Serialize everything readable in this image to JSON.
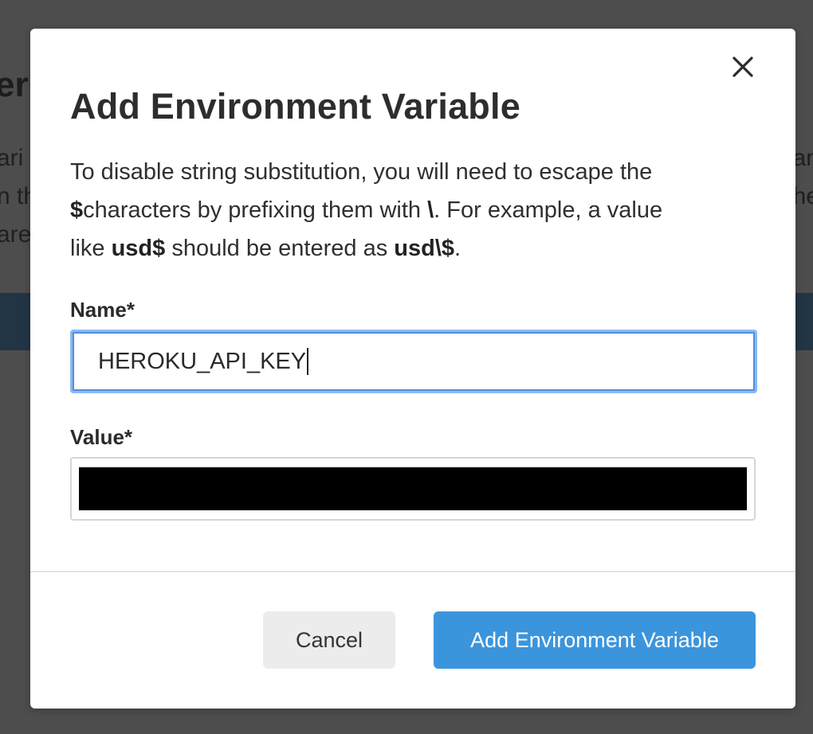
{
  "background": {
    "title_fragment": "er",
    "left_fragments": [
      "ari",
      "n th",
      "are"
    ],
    "right_fragments": [
      "an",
      "the",
      ""
    ]
  },
  "modal": {
    "title": "Add Environment Variable",
    "description": {
      "line1": "To disable string substitution, you will need to escape the",
      "dollar": "$",
      "line2_rest": "characters by prefixing them with",
      "backslash": "\\",
      "line2_end": ". For example, a value",
      "line3_start": "like",
      "example_value": "usd$",
      "line3_mid": "should be entered as",
      "escaped_value": "usd\\$",
      "line3_end": "."
    },
    "name_label": "Name*",
    "name_value": "HEROKU_API_KEY",
    "value_label": "Value*",
    "cancel_label": "Cancel",
    "submit_label": "Add Environment Variable"
  },
  "colors": {
    "primary": "#3b95dc",
    "focus_ring": "#4a90e2",
    "overlay": "#474747"
  },
  "icons": {
    "close": "close-icon"
  }
}
